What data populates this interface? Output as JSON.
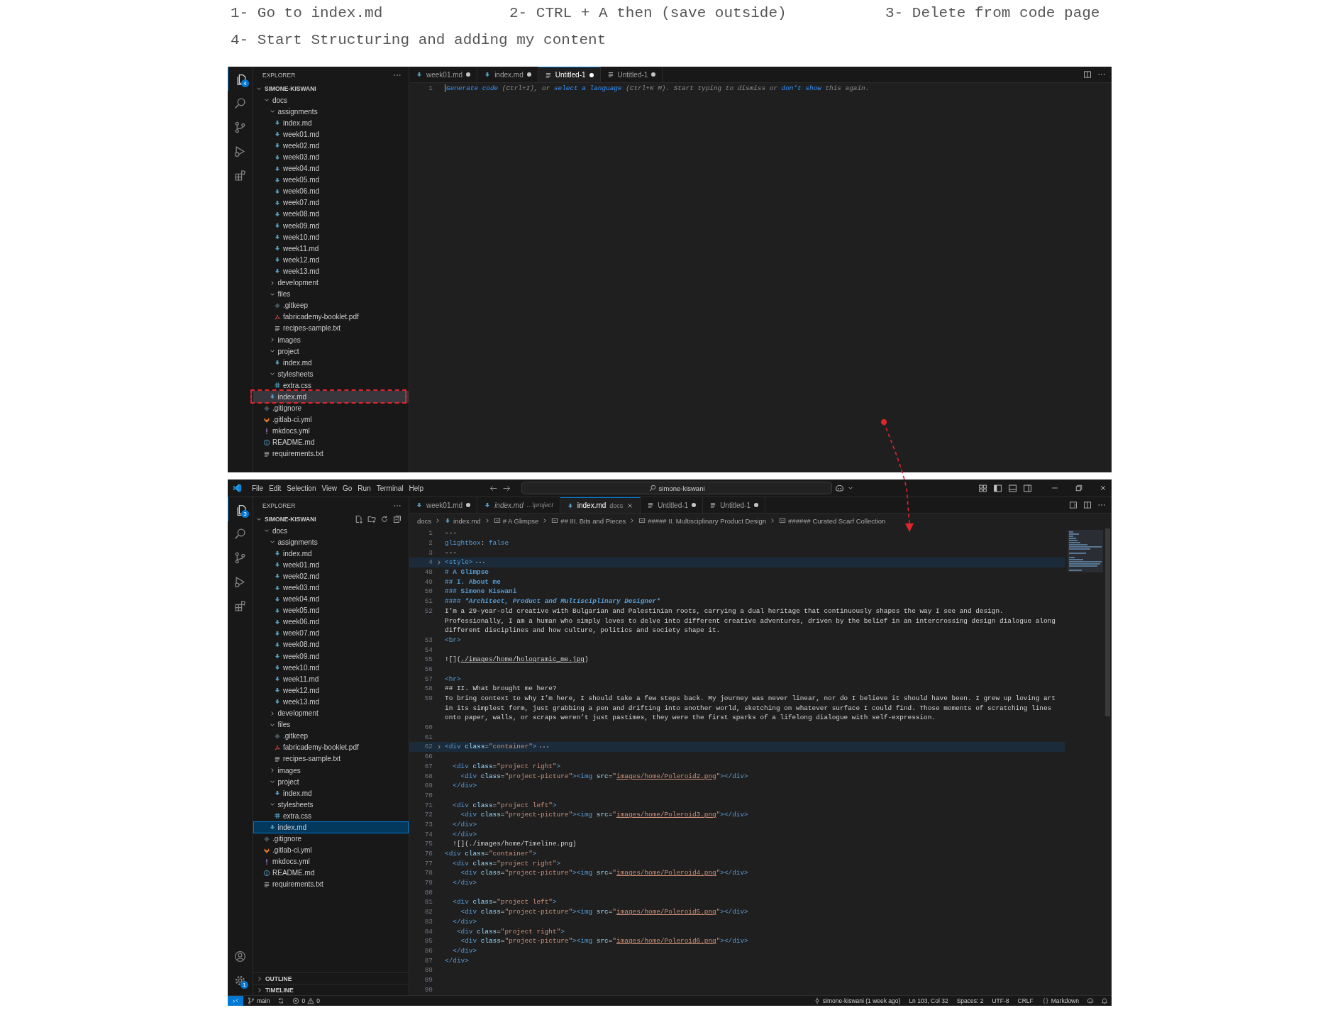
{
  "instructions": [
    "1- Go to index.md",
    "2- CTRL + A then (save outside)",
    "3- Delete from code page",
    "4- Start Structuring and adding my content"
  ],
  "windows": [
    {
      "focused": false,
      "activity_badge": "4",
      "explorer": {
        "title": "EXPLORER",
        "root": "SIMONE-KISWANI",
        "tree": [
          {
            "label": "docs",
            "kind": "folder",
            "expanded": true,
            "selected": false,
            "children": [
              {
                "label": "assignments",
                "kind": "folder",
                "expanded": true,
                "selected": false,
                "children": [
                  {
                    "label": "index.md",
                    "kind": "md",
                    "selected": false
                  },
                  {
                    "label": "week01.md",
                    "kind": "md",
                    "selected": false
                  },
                  {
                    "label": "week02.md",
                    "kind": "md",
                    "selected": false
                  },
                  {
                    "label": "week03.md",
                    "kind": "md",
                    "selected": false
                  },
                  {
                    "label": "week04.md",
                    "kind": "md",
                    "selected": false
                  },
                  {
                    "label": "week05.md",
                    "kind": "md",
                    "selected": false
                  },
                  {
                    "label": "week06.md",
                    "kind": "md",
                    "selected": false
                  },
                  {
                    "label": "week07.md",
                    "kind": "md",
                    "selected": false
                  },
                  {
                    "label": "week08.md",
                    "kind": "md",
                    "selected": false
                  },
                  {
                    "label": "week09.md",
                    "kind": "md",
                    "selected": false
                  },
                  {
                    "label": "week10.md",
                    "kind": "md",
                    "selected": false
                  },
                  {
                    "label": "week11.md",
                    "kind": "md",
                    "selected": false
                  },
                  {
                    "label": "week12.md",
                    "kind": "md",
                    "selected": false
                  },
                  {
                    "label": "week13.md",
                    "kind": "md",
                    "selected": false
                  }
                ]
              },
              {
                "label": "development",
                "kind": "folder",
                "expanded": false,
                "selected": false
              },
              {
                "label": "files",
                "kind": "folder",
                "expanded": true,
                "selected": false,
                "children": [
                  {
                    "label": ".gitkeep",
                    "kind": "gitkeep",
                    "selected": false
                  },
                  {
                    "label": "fabricademy-booklet.pdf",
                    "kind": "pdf",
                    "selected": false
                  },
                  {
                    "label": "recipes-sample.txt",
                    "kind": "txt",
                    "selected": false
                  }
                ]
              },
              {
                "label": "images",
                "kind": "folder",
                "expanded": false,
                "selected": false
              },
              {
                "label": "project",
                "kind": "folder",
                "expanded": true,
                "selected": false,
                "children": [
                  {
                    "label": "index.md",
                    "kind": "md",
                    "selected": false
                  }
                ]
              },
              {
                "label": "stylesheets",
                "kind": "folder",
                "expanded": true,
                "selected": false,
                "children": [
                  {
                    "label": "extra.css",
                    "kind": "css",
                    "selected": false
                  }
                ]
              },
              {
                "label": "index.md",
                "kind": "md",
                "selected": true
              }
            ]
          },
          {
            "label": ".gitignore",
            "kind": "git",
            "selected": false
          },
          {
            "label": ".gitlab-ci.yml",
            "kind": "gitlab",
            "selected": false
          },
          {
            "label": "mkdocs.yml",
            "kind": "yml",
            "selected": false
          },
          {
            "label": "README.md",
            "kind": "info",
            "selected": false
          },
          {
            "label": "requirements.txt",
            "kind": "txt",
            "selected": false
          }
        ]
      },
      "tabs": [
        {
          "label": "week01.md",
          "kind": "md",
          "selected": false,
          "dirty": true,
          "preview": false
        },
        {
          "label": "index.md",
          "kind": "md",
          "selected": false,
          "dirty": true,
          "preview": false
        },
        {
          "label": "Untitled-1",
          "kind": "txt",
          "selected": true,
          "dirty": true,
          "preview": false
        },
        {
          "label": "Untitled-1",
          "kind": "txt",
          "selected": false,
          "dirty": true,
          "preview": false
        }
      ],
      "editor": {
        "lines": [
          {
            "num": "1",
            "folded": false,
            "cursor": true,
            "segments": [
              {
                "kind": "hintlink",
                "text": "Generate code"
              },
              {
                "kind": "hint",
                "text": " (Ctrl+I), or "
              },
              {
                "kind": "hintlink",
                "text": "select a language"
              },
              {
                "kind": "hint",
                "text": " (Ctrl+K M). Start typing to dismiss or "
              },
              {
                "kind": "hintlink",
                "text": "don't show"
              },
              {
                "kind": "hint",
                "text": " this again."
              }
            ]
          }
        ]
      }
    },
    {
      "focused": true,
      "activity_badge": "3",
      "settings_badge": "1",
      "menu": [
        "File",
        "Edit",
        "Selection",
        "View",
        "Go",
        "Run",
        "Terminal",
        "Help"
      ],
      "search": "simone-kiswani",
      "explorer": {
        "title": "EXPLORER",
        "root": "SIMONE-KISWANI",
        "tree": [
          {
            "label": "docs",
            "kind": "folder",
            "expanded": true,
            "selected": false,
            "children": [
              {
                "label": "assignments",
                "kind": "folder",
                "expanded": true,
                "selected": false,
                "children": [
                  {
                    "label": "index.md",
                    "kind": "md",
                    "selected": false
                  },
                  {
                    "label": "week01.md",
                    "kind": "md",
                    "selected": false
                  },
                  {
                    "label": "week02.md",
                    "kind": "md",
                    "selected": false
                  },
                  {
                    "label": "week03.md",
                    "kind": "md",
                    "selected": false
                  },
                  {
                    "label": "week04.md",
                    "kind": "md",
                    "selected": false
                  },
                  {
                    "label": "week05.md",
                    "kind": "md",
                    "selected": false
                  },
                  {
                    "label": "week06.md",
                    "kind": "md",
                    "selected": false
                  },
                  {
                    "label": "week07.md",
                    "kind": "md",
                    "selected": false
                  },
                  {
                    "label": "week08.md",
                    "kind": "md",
                    "selected": false
                  },
                  {
                    "label": "week09.md",
                    "kind": "md",
                    "selected": false
                  },
                  {
                    "label": "week10.md",
                    "kind": "md",
                    "selected": false
                  },
                  {
                    "label": "week11.md",
                    "kind": "md",
                    "selected": false
                  },
                  {
                    "label": "week12.md",
                    "kind": "md",
                    "selected": false
                  },
                  {
                    "label": "week13.md",
                    "kind": "md",
                    "selected": false
                  }
                ]
              },
              {
                "label": "development",
                "kind": "folder",
                "expanded": false,
                "selected": false
              },
              {
                "label": "files",
                "kind": "folder",
                "expanded": true,
                "selected": false,
                "children": [
                  {
                    "label": ".gitkeep",
                    "kind": "gitkeep",
                    "selected": false
                  },
                  {
                    "label": "fabricademy-booklet.pdf",
                    "kind": "pdf",
                    "selected": false
                  },
                  {
                    "label": "recipes-sample.txt",
                    "kind": "txt",
                    "selected": false
                  }
                ]
              },
              {
                "label": "images",
                "kind": "folder",
                "expanded": false,
                "selected": false
              },
              {
                "label": "project",
                "kind": "folder",
                "expanded": true,
                "selected": false,
                "children": [
                  {
                    "label": "index.md",
                    "kind": "md",
                    "selected": false
                  }
                ]
              },
              {
                "label": "stylesheets",
                "kind": "folder",
                "expanded": true,
                "selected": false,
                "children": [
                  {
                    "label": "extra.css",
                    "kind": "css",
                    "selected": false
                  }
                ]
              },
              {
                "label": "index.md",
                "kind": "md",
                "selected": true
              }
            ]
          },
          {
            "label": ".gitignore",
            "kind": "git",
            "selected": false
          },
          {
            "label": ".gitlab-ci.yml",
            "kind": "gitlab",
            "selected": false
          },
          {
            "label": "mkdocs.yml",
            "kind": "yml",
            "selected": false
          },
          {
            "label": "README.md",
            "kind": "info",
            "selected": false
          },
          {
            "label": "requirements.txt",
            "kind": "txt",
            "selected": false
          }
        ]
      },
      "sections": [
        "OUTLINE",
        "TIMELINE"
      ],
      "tabs": [
        {
          "label": "week01.md",
          "kind": "md",
          "selected": false,
          "dirty": true,
          "preview": false
        },
        {
          "label": "index.md",
          "description": "...\\project",
          "kind": "md",
          "selected": false,
          "dirty": false,
          "preview": true
        },
        {
          "label": "index.md",
          "description": "docs",
          "kind": "md",
          "selected": true,
          "dirty": false,
          "preview": false
        },
        {
          "label": "Untitled-1",
          "kind": "txt",
          "selected": false,
          "dirty": true,
          "preview": false
        },
        {
          "label": "Untitled-1",
          "kind": "txt",
          "selected": false,
          "dirty": true,
          "preview": false
        }
      ],
      "breadcrumbs": [
        {
          "label": "docs",
          "kind": "folder"
        },
        {
          "label": "index.md",
          "kind": "md"
        },
        {
          "label": "# A Glimpse",
          "kind": "symbol"
        },
        {
          "label": "## III. Bits and Pieces",
          "kind": "symbol"
        },
        {
          "label": "##### II. Multisciplinary Product Design",
          "kind": "symbol"
        },
        {
          "label": "###### Curated Scarf Collection",
          "kind": "symbol"
        }
      ],
      "editor": {
        "lines": [
          {
            "num": "1",
            "folded": false,
            "segments": [
              {
                "kind": "p",
                "text": "---"
              }
            ]
          },
          {
            "num": "2",
            "folded": false,
            "segments": [
              {
                "kind": "key",
                "text": "glightbox"
              },
              {
                "kind": "p",
                "text": ": "
              },
              {
                "kind": "key",
                "text": "false"
              }
            ]
          },
          {
            "num": "3",
            "folded": false,
            "segments": [
              {
                "kind": "p",
                "text": "---"
              }
            ]
          },
          {
            "num": "4",
            "folded": true,
            "segments": [
              {
                "kind": "tag",
                "text": "<style>"
              }
            ]
          },
          {
            "num": "48",
            "folded": false,
            "segments": [
              {
                "kind": "head",
                "text": "# A Glimpse"
              }
            ]
          },
          {
            "num": "49",
            "folded": false,
            "segments": [
              {
                "kind": "head",
                "text": "## I. About me"
              }
            ]
          },
          {
            "num": "50",
            "folded": false,
            "segments": [
              {
                "kind": "head",
                "text": "### Simone Kiswani"
              }
            ]
          },
          {
            "num": "51",
            "folded": false,
            "segments": [
              {
                "kind": "head",
                "text": "#### "
              },
              {
                "kind": "headi",
                "text": "*Architect, Product and Multisciplinary Designer*"
              }
            ]
          },
          {
            "num": "52",
            "folded": false,
            "segments": [
              {
                "kind": "p",
                "text": "I’m a 29-year-old creative with Bulgarian and Palestinian roots, carrying a dual heritage that continuously shapes the way I see and design."
              }
            ],
            "more": [
              "Professionally, I am a human who simply loves to delve into different creative adventures, driven by the belief in an intercrossing design dialogue along",
              "different disciplines and how culture, politics and society shape it."
            ]
          },
          {
            "num": "53",
            "folded": false,
            "segments": [
              {
                "kind": "tag",
                "text": "<br>"
              }
            ]
          },
          {
            "num": "54",
            "folded": false
          },
          {
            "num": "55",
            "folded": false,
            "segments": [
              {
                "kind": "p",
                "text": "![]("
              },
              {
                "kind": "mlink",
                "text": "./images/home/hologramic_me.jpg"
              },
              {
                "kind": "p",
                "text": ")"
              }
            ]
          },
          {
            "num": "56",
            "folded": false
          },
          {
            "num": "57",
            "folded": false,
            "segments": [
              {
                "kind": "tag",
                "text": "<hr>"
              }
            ]
          },
          {
            "num": "58",
            "folded": false,
            "segments": [
              {
                "kind": "p",
                "text": "## II. What brought me here?"
              }
            ]
          },
          {
            "num": "59",
            "folded": false,
            "segments": [
              {
                "kind": "p",
                "text": "To bring context to why I’m here, I should take a few steps back. My journey was never linear, nor do I believe it should have been. I grew up loving art"
              }
            ],
            "more": [
              "in its simplest form, just grabbing a pen and drifting into another world, sketching on whatever surface I could find. Those moments of scratching lines",
              "onto paper, walls, or scraps weren’t just pastimes, they were the first sparks of a lifelong dialogue with self-expression."
            ]
          },
          {
            "num": "60",
            "folded": false
          },
          {
            "num": "61",
            "folded": false
          },
          {
            "num": "62",
            "folded": true,
            "segments": [
              {
                "kind": "tag",
                "text": "<div"
              },
              {
                "kind": "attr",
                "text": " class"
              },
              {
                "kind": "p",
                "text": "="
              },
              {
                "kind": "str",
                "text": "\"container\""
              },
              {
                "kind": "tag",
                "text": ">"
              }
            ]
          },
          {
            "num": "66",
            "folded": false
          },
          {
            "num": "67",
            "folded": false,
            "segments": [
              {
                "kind": "tag",
                "text": "  <div"
              },
              {
                "kind": "attr",
                "text": " class"
              },
              {
                "kind": "p",
                "text": "="
              },
              {
                "kind": "str",
                "text": "\"project right\""
              },
              {
                "kind": "tag",
                "text": ">"
              }
            ]
          },
          {
            "num": "68",
            "folded": false,
            "segments": [
              {
                "kind": "tag",
                "text": "    <div"
              },
              {
                "kind": "attr",
                "text": " class"
              },
              {
                "kind": "p",
                "text": "="
              },
              {
                "kind": "str",
                "text": "\"project-picture\""
              },
              {
                "kind": "tag",
                "text": "><img"
              },
              {
                "kind": "attr",
                "text": " src"
              },
              {
                "kind": "p",
                "text": "="
              },
              {
                "kind": "str",
                "text": "\""
              },
              {
                "kind": "link",
                "text": "images/home/Poleroid2.png"
              },
              {
                "kind": "str",
                "text": "\""
              },
              {
                "kind": "tag",
                "text": "></div>"
              }
            ]
          },
          {
            "num": "69",
            "folded": false,
            "segments": [
              {
                "kind": "tag",
                "text": "  </div>"
              }
            ]
          },
          {
            "num": "70",
            "folded": false
          },
          {
            "num": "71",
            "folded": false,
            "segments": [
              {
                "kind": "tag",
                "text": "  <div"
              },
              {
                "kind": "attr",
                "text": " class"
              },
              {
                "kind": "p",
                "text": "="
              },
              {
                "kind": "str",
                "text": "\"project left\""
              },
              {
                "kind": "tag",
                "text": ">"
              }
            ]
          },
          {
            "num": "72",
            "folded": false,
            "segments": [
              {
                "kind": "tag",
                "text": "    <div"
              },
              {
                "kind": "attr",
                "text": " class"
              },
              {
                "kind": "p",
                "text": "="
              },
              {
                "kind": "str",
                "text": "\"project-picture\""
              },
              {
                "kind": "tag",
                "text": "><img"
              },
              {
                "kind": "attr",
                "text": " src"
              },
              {
                "kind": "p",
                "text": "="
              },
              {
                "kind": "str",
                "text": "\""
              },
              {
                "kind": "link",
                "text": "images/home/Poleroid3.png"
              },
              {
                "kind": "str",
                "text": "\""
              },
              {
                "kind": "tag",
                "text": "></div>"
              }
            ]
          },
          {
            "num": "73",
            "folded": false,
            "segments": [
              {
                "kind": "tag",
                "text": "  </div>"
              }
            ]
          },
          {
            "num": "74",
            "folded": false,
            "segments": [
              {
                "kind": "tag",
                "text": "  </div>"
              }
            ]
          },
          {
            "num": "75",
            "folded": false,
            "segments": [
              {
                "kind": "p",
                "text": "  ![](./images/home/Timeline.png)"
              }
            ]
          },
          {
            "num": "76",
            "folded": false,
            "segments": [
              {
                "kind": "tag",
                "text": "<div"
              },
              {
                "kind": "attr",
                "text": " class"
              },
              {
                "kind": "p",
                "text": "="
              },
              {
                "kind": "str",
                "text": "\"container\""
              },
              {
                "kind": "tag",
                "text": ">"
              }
            ]
          },
          {
            "num": "77",
            "folded": false,
            "segments": [
              {
                "kind": "tag",
                "text": "  <div"
              },
              {
                "kind": "attr",
                "text": " class"
              },
              {
                "kind": "p",
                "text": "="
              },
              {
                "kind": "str",
                "text": "\"project right\""
              },
              {
                "kind": "tag",
                "text": ">"
              }
            ]
          },
          {
            "num": "78",
            "folded": false,
            "segments": [
              {
                "kind": "tag",
                "text": "    <div"
              },
              {
                "kind": "attr",
                "text": " class"
              },
              {
                "kind": "p",
                "text": "="
              },
              {
                "kind": "str",
                "text": "\"project-picture\""
              },
              {
                "kind": "tag",
                "text": "><img"
              },
              {
                "kind": "attr",
                "text": " src"
              },
              {
                "kind": "p",
                "text": "="
              },
              {
                "kind": "str",
                "text": "\""
              },
              {
                "kind": "link",
                "text": "images/home/Poleroid4.png"
              },
              {
                "kind": "str",
                "text": "\""
              },
              {
                "kind": "tag",
                "text": "></div>"
              }
            ]
          },
          {
            "num": "79",
            "folded": false,
            "segments": [
              {
                "kind": "tag",
                "text": "  </div>"
              }
            ]
          },
          {
            "num": "80",
            "folded": false
          },
          {
            "num": "81",
            "folded": false,
            "segments": [
              {
                "kind": "tag",
                "text": "  <div"
              },
              {
                "kind": "attr",
                "text": " class"
              },
              {
                "kind": "p",
                "text": "="
              },
              {
                "kind": "str",
                "text": "\"project left\""
              },
              {
                "kind": "tag",
                "text": ">"
              }
            ]
          },
          {
            "num": "82",
            "folded": false,
            "segments": [
              {
                "kind": "tag",
                "text": "    <div"
              },
              {
                "kind": "attr",
                "text": " class"
              },
              {
                "kind": "p",
                "text": "="
              },
              {
                "kind": "str",
                "text": "\"project-picture\""
              },
              {
                "kind": "tag",
                "text": "><img"
              },
              {
                "kind": "attr",
                "text": " src"
              },
              {
                "kind": "p",
                "text": "="
              },
              {
                "kind": "str",
                "text": "\""
              },
              {
                "kind": "link",
                "text": "images/home/Poleroid5.png"
              },
              {
                "kind": "str",
                "text": "\""
              },
              {
                "kind": "tag",
                "text": "></div>"
              }
            ]
          },
          {
            "num": "83",
            "folded": false,
            "segments": [
              {
                "kind": "tag",
                "text": "  </div>"
              }
            ]
          },
          {
            "num": "84",
            "folded": false,
            "segments": [
              {
                "kind": "tag",
                "text": "   <div"
              },
              {
                "kind": "attr",
                "text": " class"
              },
              {
                "kind": "p",
                "text": "="
              },
              {
                "kind": "str",
                "text": "\"project right\""
              },
              {
                "kind": "tag",
                "text": ">"
              }
            ]
          },
          {
            "num": "85",
            "folded": false,
            "segments": [
              {
                "kind": "tag",
                "text": "    <div"
              },
              {
                "kind": "attr",
                "text": " class"
              },
              {
                "kind": "p",
                "text": "="
              },
              {
                "kind": "str",
                "text": "\"project-picture\""
              },
              {
                "kind": "tag",
                "text": "><img"
              },
              {
                "kind": "attr",
                "text": " src"
              },
              {
                "kind": "p",
                "text": "="
              },
              {
                "kind": "str",
                "text": "\""
              },
              {
                "kind": "link",
                "text": "images/home/Poleroid6.png"
              },
              {
                "kind": "str",
                "text": "\""
              },
              {
                "kind": "tag",
                "text": "></div>"
              }
            ]
          },
          {
            "num": "86",
            "folded": false,
            "segments": [
              {
                "kind": "tag",
                "text": "  </div>"
              }
            ]
          },
          {
            "num": "87",
            "folded": false,
            "segments": [
              {
                "kind": "tag",
                "text": "</div>"
              }
            ]
          },
          {
            "num": "88",
            "folded": false
          },
          {
            "num": "89",
            "folded": false
          },
          {
            "num": "90",
            "folded": false
          }
        ]
      },
      "status": {
        "branch": "main",
        "errors": "0",
        "warnings": "0",
        "blame": "simone-kiswani (1 week ago)",
        "position": "Ln 103, Col 32",
        "indent": "Spaces: 2",
        "encoding": "UTF-8",
        "eol": "CRLF",
        "language": "Markdown"
      }
    }
  ],
  "annotations": [
    {
      "kind": "dashed-box"
    },
    {
      "kind": "arrow"
    }
  ]
}
